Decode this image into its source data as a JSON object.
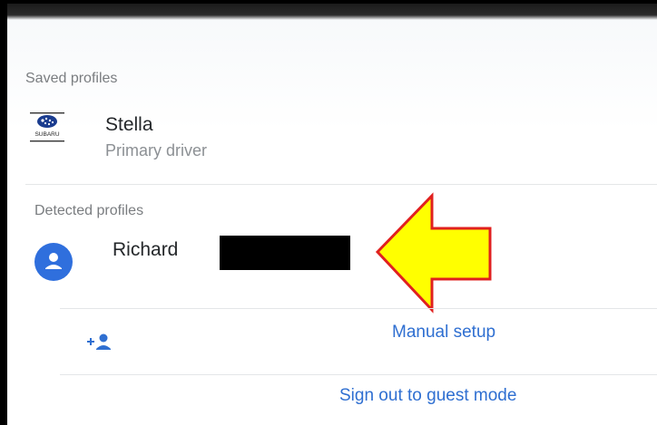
{
  "saved_section": {
    "label": "Saved profiles"
  },
  "saved_profiles": [
    {
      "name": "Stella",
      "role": "Primary driver",
      "logo_text": "SUBARU",
      "icon": "subaru-logo-icon"
    }
  ],
  "detected_section": {
    "label": "Detected profiles"
  },
  "detected_profiles": [
    {
      "name": "Richard",
      "icon": "person-avatar-icon"
    }
  ],
  "actions": {
    "manual_setup": {
      "label": "Manual setup",
      "icon": "add-person-icon"
    },
    "guest_mode": {
      "label": "Sign out to guest mode"
    }
  },
  "colors": {
    "accent": "#2f6fd1",
    "avatar": "#2f6fdd",
    "arrow_fill": "#ffff00",
    "arrow_stroke": "#e0201f"
  }
}
